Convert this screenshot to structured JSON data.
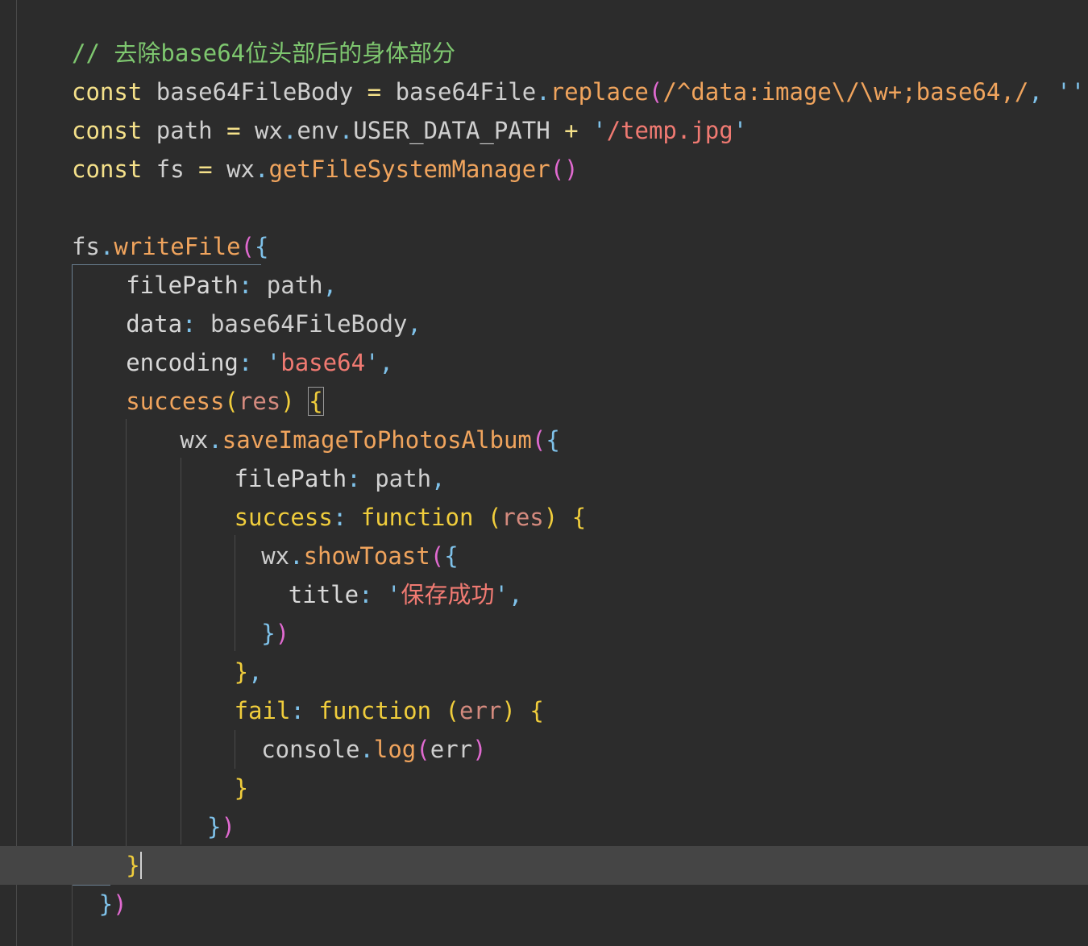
{
  "editor": {
    "lines": [
      {
        "row": 0,
        "indent": 0,
        "tokens": [
          {
            "t": "// 去除base64位头部后的身体部分",
            "c": "comment"
          }
        ]
      },
      {
        "row": 1,
        "indent": 0,
        "tokens": [
          {
            "t": "const",
            "c": "kw"
          },
          {
            "t": " base64FileBody ",
            "c": "var"
          },
          {
            "t": "=",
            "c": "op"
          },
          {
            "t": " base64File",
            "c": "var"
          },
          {
            "t": ".",
            "c": "punct"
          },
          {
            "t": "replace",
            "c": "fn"
          },
          {
            "t": "(",
            "c": "br2"
          },
          {
            "t": "/^data:image\\/\\w+;base64,/",
            "c": "regex"
          },
          {
            "t": ", ",
            "c": "punct"
          },
          {
            "t": "''",
            "c": "quote"
          },
          {
            "t": ")",
            "c": "br2"
          }
        ]
      },
      {
        "row": 2,
        "indent": 0,
        "tokens": [
          {
            "t": "const",
            "c": "kw"
          },
          {
            "t": " path ",
            "c": "var"
          },
          {
            "t": "=",
            "c": "op"
          },
          {
            "t": " wx",
            "c": "var"
          },
          {
            "t": ".",
            "c": "punct"
          },
          {
            "t": "env",
            "c": "var"
          },
          {
            "t": ".",
            "c": "punct"
          },
          {
            "t": "USER_DATA_PATH ",
            "c": "var"
          },
          {
            "t": "+",
            "c": "op"
          },
          {
            "t": " '",
            "c": "quote"
          },
          {
            "t": "/temp.jpg",
            "c": "str"
          },
          {
            "t": "'",
            "c": "quote"
          }
        ]
      },
      {
        "row": 3,
        "indent": 0,
        "tokens": [
          {
            "t": "const",
            "c": "kw"
          },
          {
            "t": " fs ",
            "c": "var"
          },
          {
            "t": "=",
            "c": "op"
          },
          {
            "t": " wx",
            "c": "var"
          },
          {
            "t": ".",
            "c": "punct"
          },
          {
            "t": "getFileSystemManager",
            "c": "fn"
          },
          {
            "t": "()",
            "c": "br2"
          }
        ]
      },
      {
        "row": 4,
        "indent": 0,
        "tokens": []
      },
      {
        "row": 5,
        "indent": 0,
        "tokens": [
          {
            "t": "fs",
            "c": "var"
          },
          {
            "t": ".",
            "c": "punct"
          },
          {
            "t": "writeFile",
            "c": "fn"
          },
          {
            "t": "(",
            "c": "br2"
          },
          {
            "t": "{",
            "c": "br3"
          }
        ]
      },
      {
        "row": 6,
        "indent": 2,
        "tokens": [
          {
            "t": "filePath",
            "c": "prop"
          },
          {
            "t": ": ",
            "c": "punct"
          },
          {
            "t": "path",
            "c": "var"
          },
          {
            "t": ",",
            "c": "punct"
          }
        ]
      },
      {
        "row": 7,
        "indent": 2,
        "tokens": [
          {
            "t": "data",
            "c": "prop"
          },
          {
            "t": ": ",
            "c": "punct"
          },
          {
            "t": "base64FileBody",
            "c": "var"
          },
          {
            "t": ",",
            "c": "punct"
          }
        ]
      },
      {
        "row": 8,
        "indent": 2,
        "tokens": [
          {
            "t": "encoding",
            "c": "prop"
          },
          {
            "t": ": ",
            "c": "punct"
          },
          {
            "t": "'",
            "c": "quote"
          },
          {
            "t": "base64",
            "c": "str"
          },
          {
            "t": "'",
            "c": "quote"
          },
          {
            "t": ",",
            "c": "punct"
          }
        ]
      },
      {
        "row": 9,
        "indent": 2,
        "tokens": [
          {
            "t": "success",
            "c": "fn"
          },
          {
            "t": "(",
            "c": "br1"
          },
          {
            "t": "res",
            "c": "param"
          },
          {
            "t": ")",
            "c": "br1"
          },
          {
            "t": " ",
            "c": "var"
          },
          {
            "t": "{",
            "c": "br1",
            "match": true
          }
        ]
      },
      {
        "row": 10,
        "indent": 4,
        "tokens": [
          {
            "t": "wx",
            "c": "var"
          },
          {
            "t": ".",
            "c": "punct"
          },
          {
            "t": "saveImageToPhotosAlbum",
            "c": "fn"
          },
          {
            "t": "(",
            "c": "br2"
          },
          {
            "t": "{",
            "c": "br3"
          }
        ]
      },
      {
        "row": 11,
        "indent": 6,
        "tokens": [
          {
            "t": "filePath",
            "c": "prop"
          },
          {
            "t": ": ",
            "c": "punct"
          },
          {
            "t": "path",
            "c": "var"
          },
          {
            "t": ",",
            "c": "punct"
          }
        ]
      },
      {
        "row": 12,
        "indent": 6,
        "tokens": [
          {
            "t": "success",
            "c": "key"
          },
          {
            "t": ": ",
            "c": "punct"
          },
          {
            "t": "function",
            "c": "key"
          },
          {
            "t": " ",
            "c": "var"
          },
          {
            "t": "(",
            "c": "br1"
          },
          {
            "t": "res",
            "c": "param"
          },
          {
            "t": ")",
            "c": "br1"
          },
          {
            "t": " ",
            "c": "var"
          },
          {
            "t": "{",
            "c": "br1"
          }
        ]
      },
      {
        "row": 13,
        "indent": 7,
        "tokens": [
          {
            "t": "wx",
            "c": "var"
          },
          {
            "t": ".",
            "c": "punct"
          },
          {
            "t": "showToast",
            "c": "fn"
          },
          {
            "t": "(",
            "c": "br2"
          },
          {
            "t": "{",
            "c": "br3"
          }
        ]
      },
      {
        "row": 14,
        "indent": 8,
        "tokens": [
          {
            "t": "title",
            "c": "prop"
          },
          {
            "t": ": ",
            "c": "punct"
          },
          {
            "t": "'",
            "c": "quote"
          },
          {
            "t": "保存成功",
            "c": "str"
          },
          {
            "t": "'",
            "c": "quote"
          },
          {
            "t": ",",
            "c": "punct"
          }
        ]
      },
      {
        "row": 15,
        "indent": 7,
        "tokens": [
          {
            "t": "}",
            "c": "br3"
          },
          {
            "t": ")",
            "c": "br2"
          }
        ]
      },
      {
        "row": 16,
        "indent": 6,
        "tokens": [
          {
            "t": "}",
            "c": "br1"
          },
          {
            "t": ",",
            "c": "punct"
          }
        ]
      },
      {
        "row": 17,
        "indent": 6,
        "tokens": [
          {
            "t": "fail",
            "c": "key"
          },
          {
            "t": ": ",
            "c": "punct"
          },
          {
            "t": "function",
            "c": "key"
          },
          {
            "t": " ",
            "c": "var"
          },
          {
            "t": "(",
            "c": "br1"
          },
          {
            "t": "err",
            "c": "param"
          },
          {
            "t": ")",
            "c": "br1"
          },
          {
            "t": " ",
            "c": "var"
          },
          {
            "t": "{",
            "c": "br1"
          }
        ]
      },
      {
        "row": 18,
        "indent": 7,
        "tokens": [
          {
            "t": "console",
            "c": "var"
          },
          {
            "t": ".",
            "c": "punct"
          },
          {
            "t": "log",
            "c": "fn"
          },
          {
            "t": "(",
            "c": "br2"
          },
          {
            "t": "err",
            "c": "var"
          },
          {
            "t": ")",
            "c": "br2"
          }
        ]
      },
      {
        "row": 19,
        "indent": 6,
        "tokens": [
          {
            "t": "}",
            "c": "br1"
          }
        ]
      },
      {
        "row": 20,
        "indent": 5,
        "tokens": [
          {
            "t": "}",
            "c": "br3"
          },
          {
            "t": ")",
            "c": "br2"
          }
        ]
      },
      {
        "row": 21,
        "indent": 2,
        "current": true,
        "tokens": [
          {
            "t": "}",
            "c": "br1",
            "cursor": true
          }
        ]
      },
      {
        "row": 22,
        "indent": 1,
        "tokens": [
          {
            "t": "}",
            "c": "br3"
          },
          {
            "t": ")",
            "c": "br2"
          }
        ]
      }
    ]
  }
}
